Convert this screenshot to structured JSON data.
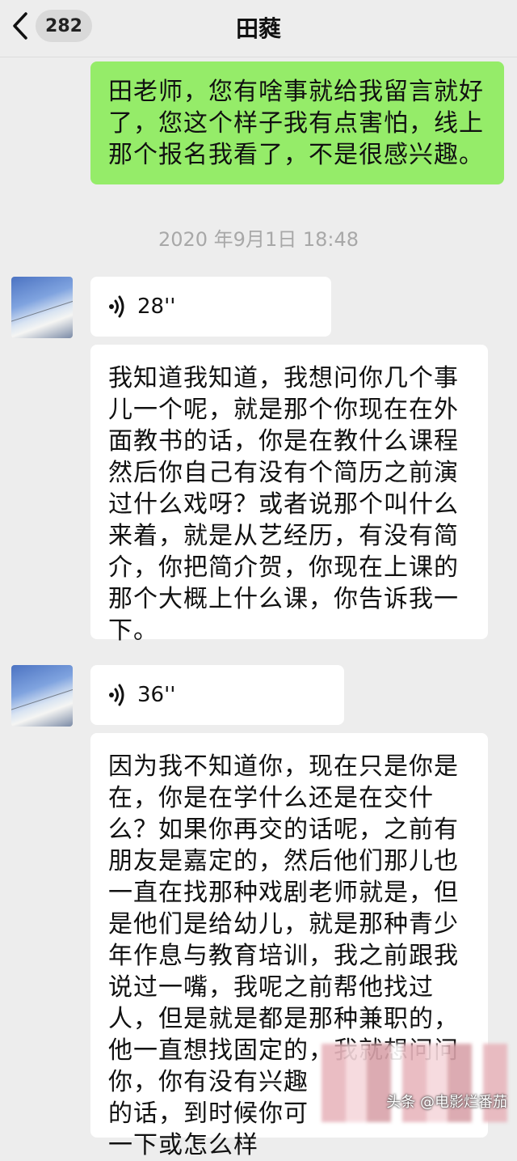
{
  "header": {
    "back_count": "282",
    "contact_name": "田蕤"
  },
  "messages": [
    {
      "from": "me",
      "lines": [
        "田老师，您有啥事就给我留言就好",
        "了，您这个样子我有点害怕，线上",
        "那个报名我看了，不是很感兴趣。"
      ]
    },
    {
      "timestamp": "2020 年9月1日 18:48"
    },
    {
      "from": "other",
      "type": "voice",
      "duration": "28''",
      "lines": [
        "我知道我知道，我想问你几个事",
        "儿一个呢，就是那个你现在在外",
        "面教书的话，你是在教什么课程",
        "然后你自己有没有个简历之前演",
        "过什么戏呀？或者说那个叫什么",
        "来着，就是从艺经历，有没有简",
        "介，你把简介贺，你现在上课的",
        "那个大概上什么课，你告诉我一",
        "下。"
      ]
    },
    {
      "from": "other",
      "type": "voice",
      "duration": "36''",
      "lines": [
        "因为我不知道你，现在只是你是",
        "在，你是在学什么还是在交什",
        "么？如果你再交的话呢，之前有",
        "朋友是嘉定的，然后他们那儿也",
        "一直在找那种戏剧老师就是，但",
        "是他们是给幼儿，就是那种青少",
        "年作息与教育培训，我之前跟我",
        "说过一嘴，我呢之前帮他找过",
        "人，但是就是都是那种兼职的，",
        "他一直想找固定的，我就想问问",
        "你，你有没有兴趣",
        "的话，到时候你可",
        "一下或怎么样"
      ]
    }
  ],
  "watermark": "头条 @电影烂番茄",
  "colors": {
    "self_bubble": "#95ec69",
    "other_bubble": "#ffffff",
    "background": "#ededed"
  }
}
